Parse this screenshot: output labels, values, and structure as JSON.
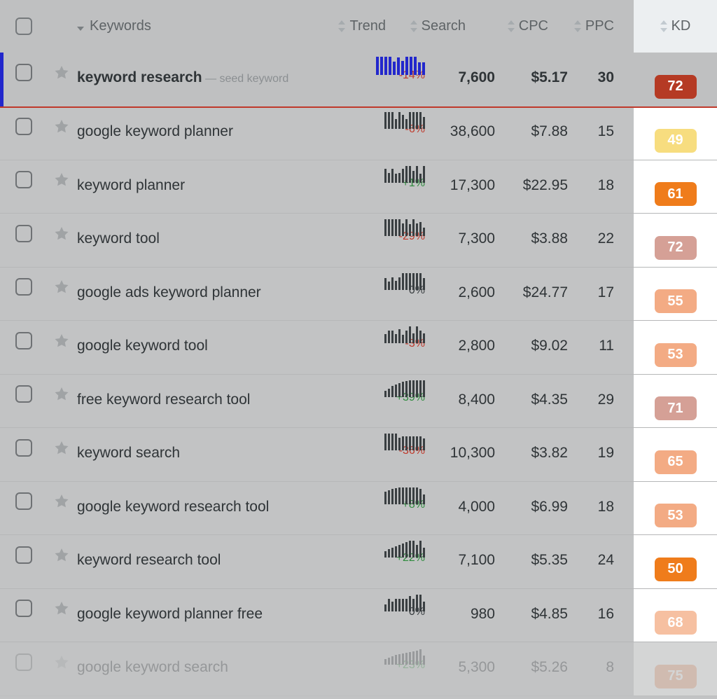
{
  "header": {
    "select_all_label": "select-all",
    "columns": [
      {
        "key": "keywords",
        "label": "Keywords",
        "sort": "caret-down"
      },
      {
        "key": "trend",
        "label": "Trend",
        "sort": "updown"
      },
      {
        "key": "search",
        "label": "Search",
        "sort": "updown"
      },
      {
        "key": "cpc",
        "label": "CPC",
        "sort": "updown"
      },
      {
        "key": "ppc",
        "label": "PPC",
        "sort": "updown"
      },
      {
        "key": "kd",
        "label": "KD",
        "sort": "updown"
      }
    ]
  },
  "colors": {
    "page_bg": "#c2c3c4",
    "header_bg": "#bfc0c1",
    "kd_header_bg": "#eceff1",
    "seed_accent": "#2227cc",
    "seed_underline": "#c0392b",
    "trend_negative": "#c0392b",
    "trend_positive": "#2e8b3d",
    "sparkline": "#3a3f42",
    "sparkline_seed": "#2227cc"
  },
  "rows": [
    {
      "keyword": "keyword research",
      "note": "— seed keyword",
      "seed": true,
      "trend": "-14%",
      "trend_dir": "neg",
      "sparkline": [
        26,
        26,
        26,
        26,
        19,
        25,
        20,
        26,
        26,
        26,
        18,
        18
      ],
      "search": "7,600",
      "cpc": "$5.17",
      "ppc": "30",
      "kd": "72",
      "kd_color": "#b53a24"
    },
    {
      "keyword": "google keyword planner",
      "note": "",
      "seed": false,
      "trend": "-6%",
      "trend_dir": "neg",
      "sparkline": [
        24,
        24,
        24,
        14,
        24,
        20,
        14,
        24,
        24,
        24,
        24,
        17
      ],
      "search": "38,600",
      "cpc": "$7.88",
      "ppc": "15",
      "kd": "49",
      "kd_color": "#f7dd7f"
    },
    {
      "keyword": "keyword planner",
      "note": "",
      "seed": false,
      "trend": "+1%",
      "trend_dir": "pos",
      "sparkline": [
        20,
        14,
        20,
        13,
        14,
        20,
        24,
        24,
        17,
        24,
        13,
        24
      ],
      "search": "17,300",
      "cpc": "$22.95",
      "ppc": "18",
      "kd": "61",
      "kd_color": "#ef7c1b"
    },
    {
      "keyword": "keyword tool",
      "note": "",
      "seed": false,
      "trend": "-29%",
      "trend_dir": "neg",
      "sparkline": [
        24,
        24,
        24,
        24,
        24,
        18,
        24,
        17,
        24,
        18,
        20,
        12
      ],
      "search": "7,300",
      "cpc": "$3.88",
      "ppc": "22",
      "kd": "72",
      "kd_color": "#d5a096"
    },
    {
      "keyword": "google ads keyword planner",
      "note": "",
      "seed": false,
      "trend": "0%",
      "trend_dir": "zero",
      "sparkline": [
        17,
        12,
        18,
        13,
        18,
        24,
        24,
        24,
        24,
        24,
        24,
        17
      ],
      "search": "2,600",
      "cpc": "$24.77",
      "ppc": "17",
      "kd": "55",
      "kd_color": "#f3ab84"
    },
    {
      "keyword": "google keyword tool",
      "note": "",
      "seed": false,
      "trend": "-3%",
      "trend_dir": "neg",
      "sparkline": [
        13,
        18,
        18,
        13,
        20,
        12,
        18,
        24,
        14,
        24,
        18,
        14
      ],
      "search": "2,800",
      "cpc": "$9.02",
      "ppc": "11",
      "kd": "53",
      "kd_color": "#f3ab84"
    },
    {
      "keyword": "free keyword research tool",
      "note": "",
      "seed": false,
      "trend": "+39%",
      "trend_dir": "pos",
      "sparkline": [
        9,
        12,
        16,
        18,
        20,
        22,
        23,
        24,
        24,
        24,
        24,
        24
      ],
      "search": "8,400",
      "cpc": "$4.35",
      "ppc": "29",
      "kd": "71",
      "kd_color": "#d5a096"
    },
    {
      "keyword": "keyword search",
      "note": "",
      "seed": false,
      "trend": "-36%",
      "trend_dir": "neg",
      "sparkline": [
        24,
        24,
        24,
        24,
        18,
        20,
        20,
        20,
        20,
        20,
        20,
        17
      ],
      "search": "10,300",
      "cpc": "$3.82",
      "ppc": "19",
      "kd": "65",
      "kd_color": "#f3ab84"
    },
    {
      "keyword": "google keyword research tool",
      "note": "",
      "seed": false,
      "trend": "+8%",
      "trend_dir": "pos",
      "sparkline": [
        18,
        20,
        22,
        23,
        24,
        24,
        24,
        24,
        24,
        24,
        22,
        14
      ],
      "search": "4,000",
      "cpc": "$6.99",
      "ppc": "18",
      "kd": "53",
      "kd_color": "#f3ab84"
    },
    {
      "keyword": "keyword research tool",
      "note": "",
      "seed": false,
      "trend": "+22%",
      "trend_dir": "pos",
      "sparkline": [
        9,
        12,
        14,
        16,
        18,
        20,
        22,
        24,
        24,
        18,
        24,
        14
      ],
      "search": "7,100",
      "cpc": "$5.35",
      "ppc": "24",
      "kd": "50",
      "kd_color": "#ef7c1b"
    },
    {
      "keyword": "google keyword planner free",
      "note": "",
      "seed": false,
      "trend": "0%",
      "trend_dir": "zero",
      "sparkline": [
        10,
        18,
        14,
        18,
        18,
        18,
        18,
        22,
        18,
        24,
        24,
        14
      ],
      "search": "980",
      "cpc": "$4.85",
      "ppc": "16",
      "kd": "68",
      "kd_color": "#f6c0a1"
    },
    {
      "keyword": "google keyword search",
      "note": "",
      "seed": false,
      "faded": true,
      "trend": "+23%",
      "trend_dir": "pos",
      "sparkline": [
        8,
        10,
        12,
        14,
        15,
        16,
        17,
        18,
        19,
        20,
        22,
        13
      ],
      "search": "5,300",
      "cpc": "$5.26",
      "ppc": "8",
      "kd": "75",
      "kd_color": "#f3ab84"
    }
  ]
}
